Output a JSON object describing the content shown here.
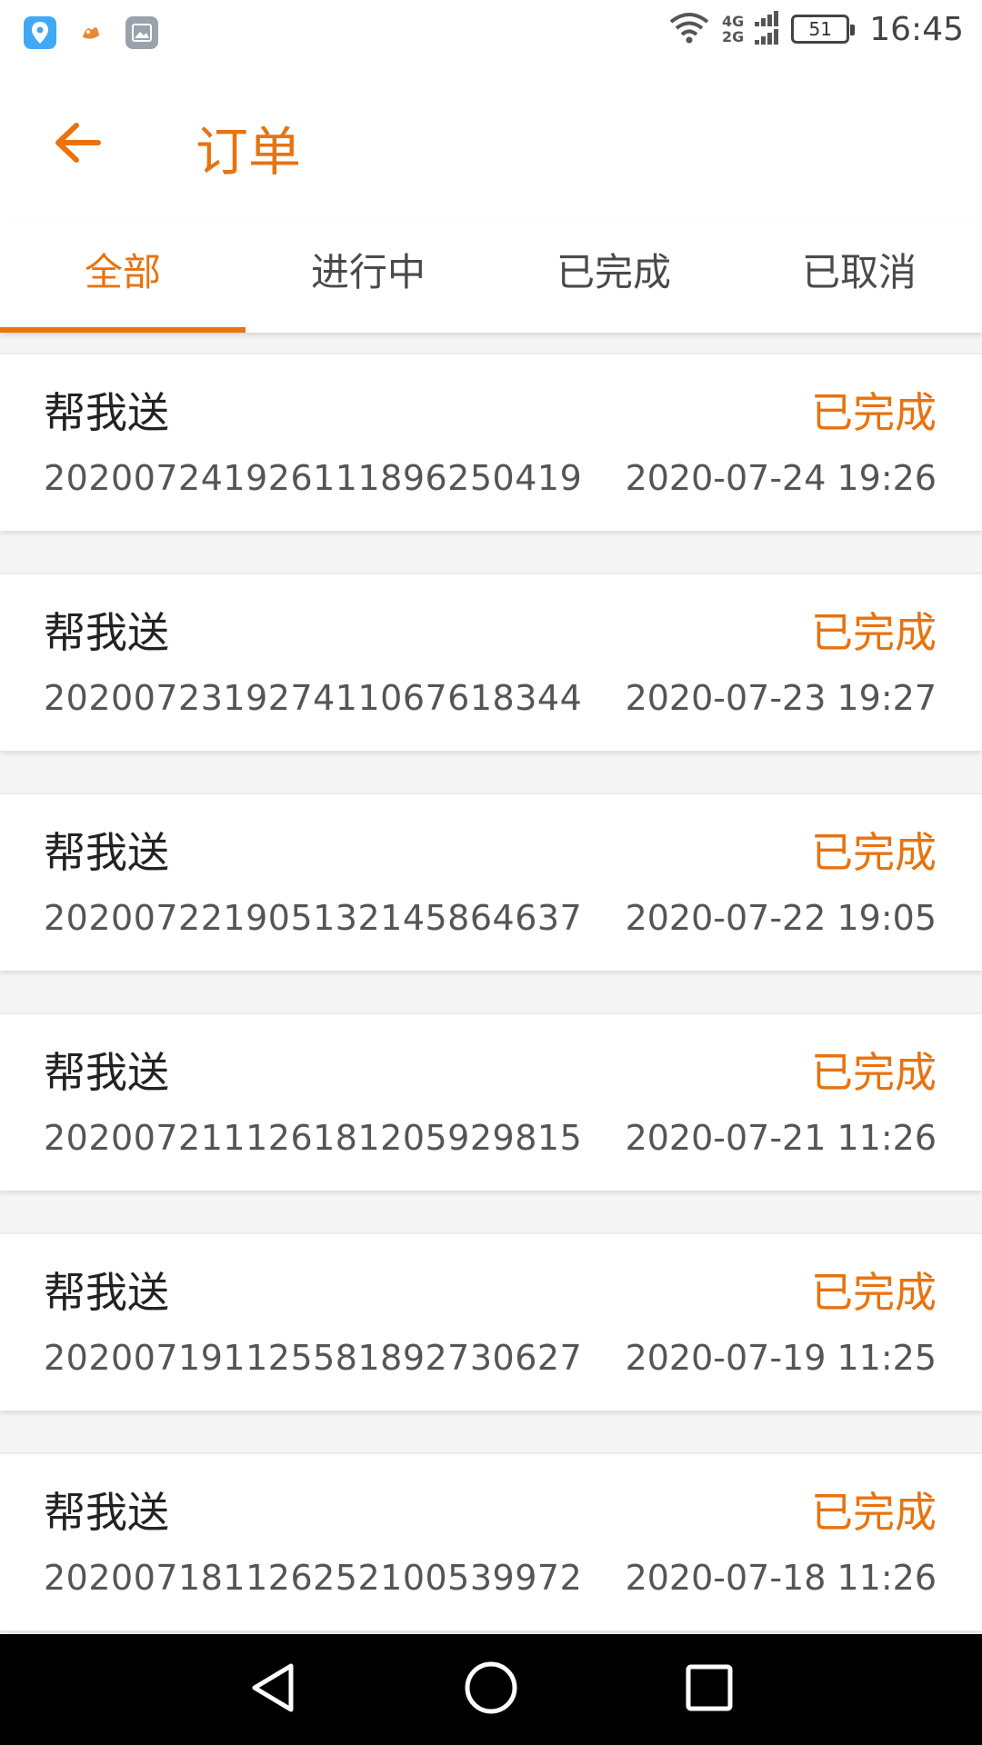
{
  "status_bar": {
    "time": "16:45",
    "battery": "51",
    "network_top": "4G",
    "network_bottom": "2G"
  },
  "header": {
    "title": "订单",
    "back_icon": "arrow-left-icon"
  },
  "tabs": [
    {
      "label": "全部",
      "active": true
    },
    {
      "label": "进行中",
      "active": false
    },
    {
      "label": "已完成",
      "active": false
    },
    {
      "label": "已取消",
      "active": false
    }
  ],
  "orders": [
    {
      "service": "帮我送",
      "status": "已完成",
      "number": "202007241926111896250419",
      "time": "2020-07-24 19:26"
    },
    {
      "service": "帮我送",
      "status": "已完成",
      "number": "202007231927411067618344",
      "time": "2020-07-23 19:27"
    },
    {
      "service": "帮我送",
      "status": "已完成",
      "number": "202007221905132145864637",
      "time": "2020-07-22 19:05"
    },
    {
      "service": "帮我送",
      "status": "已完成",
      "number": "202007211126181205929815",
      "time": "2020-07-21 11:26"
    },
    {
      "service": "帮我送",
      "status": "已完成",
      "number": "202007191125581892730627",
      "time": "2020-07-19 11:25"
    },
    {
      "service": "帮我送",
      "status": "已完成",
      "number": "202007181126252100539972",
      "time": "2020-07-18 11:26"
    }
  ],
  "colors": {
    "accent": "#e8730f",
    "text_primary": "#222222",
    "text_secondary": "#555555"
  }
}
